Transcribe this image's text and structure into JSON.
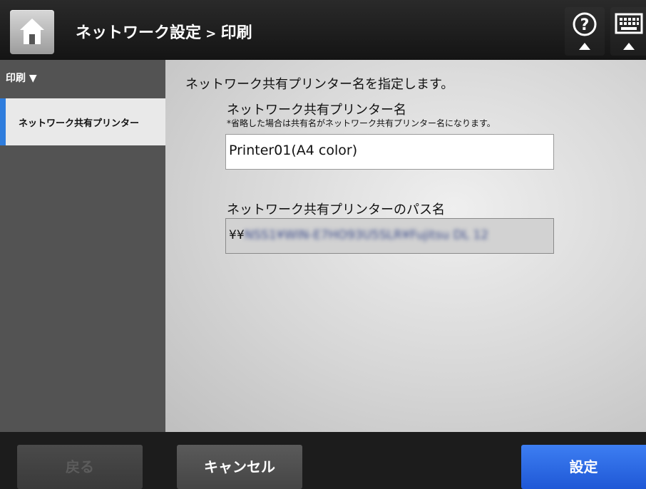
{
  "header": {
    "title_part1": "ネットワーク設定",
    "separator": " > ",
    "title_part2": "印刷",
    "icons": {
      "home": "home-icon",
      "help": "help-icon",
      "keyboard": "keyboard-icon"
    }
  },
  "sidebar": {
    "section_label": "印刷 ▼",
    "items": [
      {
        "label": "ネットワーク共有プリンター",
        "selected": true
      }
    ]
  },
  "main": {
    "instruction": "ネットワーク共有プリンター名を指定します。",
    "printer_name_label": "ネットワーク共有プリンター名",
    "printer_name_note": "*省略した場合は共有名がネットワーク共有プリンター名になります。",
    "printer_name_value": "Printer01(A4 color)",
    "path_label": "ネットワーク共有プリンターのパス名",
    "path_prefix": "¥¥",
    "path_blurred": "NSS1¥WIN-E7HO93U5SLR¥Fujitsu DL 12"
  },
  "footer": {
    "back_label": "戻る",
    "cancel_label": "キャンセル",
    "set_label": "設定"
  },
  "colors": {
    "accent_blue": "#2f7ddd",
    "primary_button": "#1f58d6"
  }
}
